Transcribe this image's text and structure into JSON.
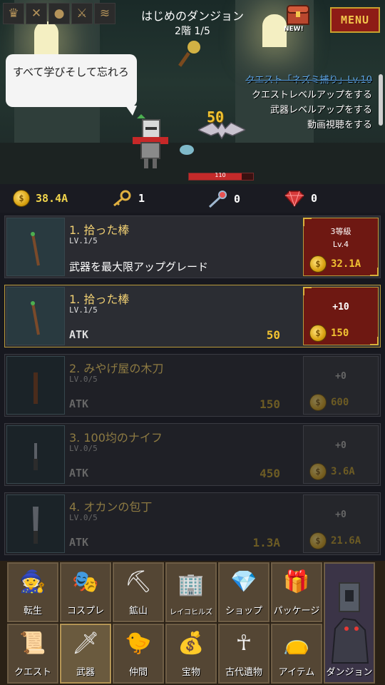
{
  "header": {
    "stage_title": "はじめのダンジョン",
    "stage_floor": "2階 1/5",
    "menu_label": "MENU",
    "new_badge": "NEW!",
    "top_icons": [
      "crown-icon",
      "crossed-swords-icon",
      "coin-icon",
      "sword-icon",
      "scroll-icon"
    ]
  },
  "scene": {
    "speech": "すべて学びそして忘れろ",
    "damage": "50",
    "hp_text": "110",
    "hp_fraction": 0.82,
    "quests": [
      "クエスト「ネズミ捕り」Lv.10",
      "クエストレベルアップをする",
      "武器レベルアップをする",
      "動画視聴をする"
    ]
  },
  "currency": {
    "gold": "38.4A",
    "keys": "1",
    "scepter": "0",
    "gems": "0"
  },
  "weapons": [
    {
      "name": "1. 拾った棒",
      "level": "LV.1/5",
      "desc": "武器を最大限アップグレード",
      "buy_top": "3等級",
      "buy_sub": "Lv.4",
      "cost": "32.1A"
    },
    {
      "name": "1. 拾った棒",
      "level": "LV.1/5",
      "stat": "ATK",
      "value": "50",
      "buy_top": "+10",
      "cost": "150"
    },
    {
      "name": "2. みやげ屋の木刀",
      "level": "LV.0/5",
      "stat": "ATK",
      "value": "150",
      "buy_top": "+0",
      "cost": "600"
    },
    {
      "name": "3. 100均のナイフ",
      "level": "LV.0/5",
      "stat": "ATK",
      "value": "450",
      "buy_top": "+0",
      "cost": "3.6A"
    },
    {
      "name": "4. オカンの包丁",
      "level": "LV.0/5",
      "stat": "ATK",
      "value": "1.3A",
      "buy_top": "+0",
      "cost": "21.6A"
    }
  ],
  "nav": {
    "row1": [
      "転生",
      "コスプレ",
      "鉱山",
      "レイコヒルズ",
      "ショップ",
      "パッケージ"
    ],
    "row2": [
      "クエスト",
      "武器",
      "仲間",
      "宝物",
      "古代遺物",
      "アイテム",
      "ダンジョン"
    ]
  },
  "colors": {
    "accent_gold": "#f1c232",
    "menu_red": "#8e1c16",
    "buy_red": "#6e1812"
  }
}
